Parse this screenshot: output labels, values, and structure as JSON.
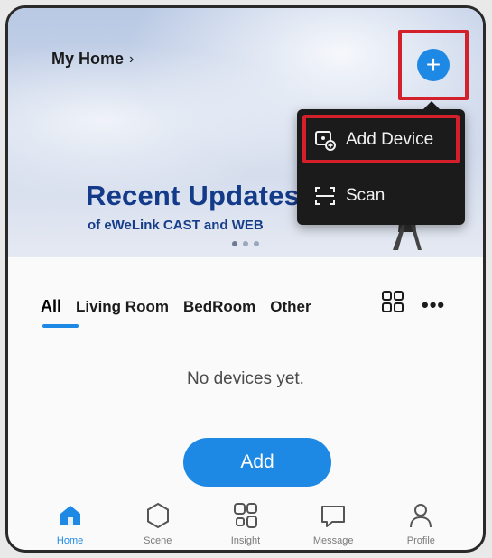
{
  "header": {
    "home_title": "My Home",
    "home_chevron": "›"
  },
  "banner": {
    "title": "Recent Updates",
    "subtitle": "of eWeLink CAST and WEB",
    "dots": 3,
    "active_dot": 0
  },
  "add_button": {
    "icon": "plus-icon",
    "glyph": "+"
  },
  "menu": {
    "items": [
      {
        "label": "Add Device",
        "icon": "add-device-icon"
      },
      {
        "label": "Scan",
        "icon": "scan-icon"
      }
    ]
  },
  "tabs": [
    {
      "label": "All",
      "active": true
    },
    {
      "label": "Living Room",
      "active": false
    },
    {
      "label": "BedRoom",
      "active": false
    },
    {
      "label": "Other",
      "active": false
    }
  ],
  "toolbar": {
    "more_glyph": "•••"
  },
  "empty_state": {
    "message": "No devices yet."
  },
  "primary_action": {
    "label": "Add"
  },
  "bottom_nav": [
    {
      "label": "Home",
      "icon": "home-icon",
      "active": true
    },
    {
      "label": "Scene",
      "icon": "scene-icon",
      "active": false
    },
    {
      "label": "Insight",
      "icon": "insight-icon",
      "active": false
    },
    {
      "label": "Message",
      "icon": "message-icon",
      "active": false
    },
    {
      "label": "Profile",
      "icon": "profile-icon",
      "active": false
    }
  ],
  "colors": {
    "accent": "#1e88e5",
    "highlight_border": "#d3202b",
    "menu_bg": "#1b1b1b",
    "banner_title": "#143a8a"
  }
}
